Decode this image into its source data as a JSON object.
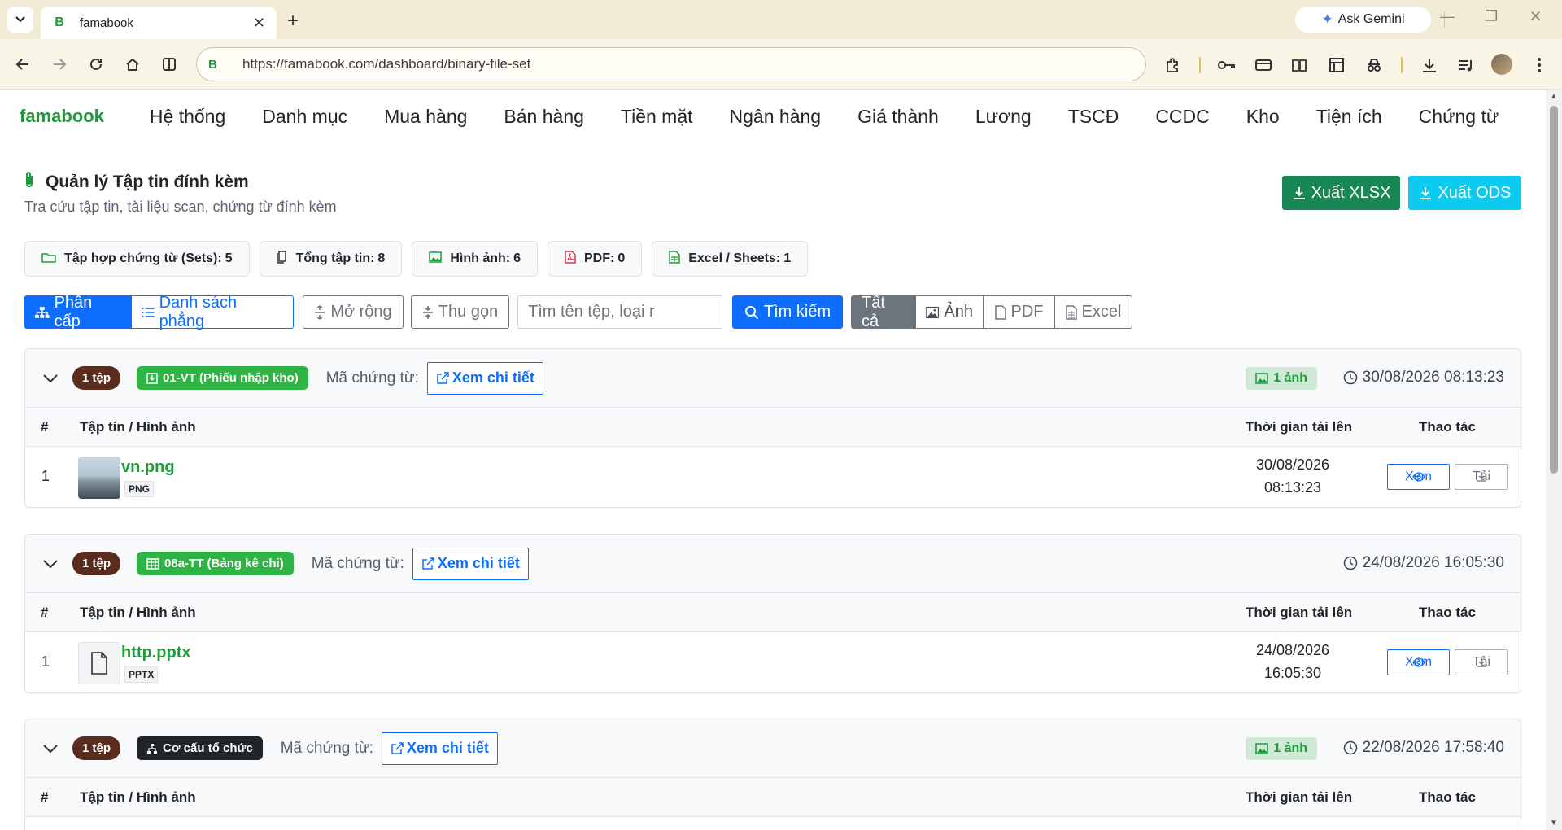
{
  "browser": {
    "tab_title": "famabook",
    "url": "https://famabook.com/dashboard/binary-file-set",
    "gemini_label": "Ask Gemini"
  },
  "nav": {
    "brand": "famabook",
    "items": [
      "Hệ thống",
      "Danh mục",
      "Mua hàng",
      "Bán hàng",
      "Tiền mặt",
      "Ngân hàng",
      "Giá thành",
      "Lương",
      "TSCĐ",
      "CCDC",
      "Kho",
      "Tiện ích",
      "Chứng từ"
    ]
  },
  "header": {
    "title": "Quản lý Tập tin đính kèm",
    "subtitle": "Tra cứu tập tin, tài liệu scan, chứng từ đính kèm",
    "export_xlsx": "Xuất XLSX",
    "export_ods": "Xuất ODS"
  },
  "stats": {
    "sets_label": "Tập hợp chứng từ (Sets):",
    "sets_value": "5",
    "files_label": "Tổng tập tin:",
    "files_value": "8",
    "images_label": "Hình ảnh:",
    "images_value": "6",
    "pdf_label": "PDF:",
    "pdf_value": "0",
    "excel_label": "Excel / Sheets:",
    "excel_value": "1"
  },
  "controls": {
    "hierarchy": "Phân cấp",
    "flat_list": "Danh sách phẳng",
    "expand": "Mở rộng",
    "collapse": "Thu gọn",
    "search_placeholder": "Tìm tên tệp, loại r",
    "search_button": "Tìm kiếm",
    "filter_all": "Tất cả",
    "filter_image": "Ảnh",
    "filter_pdf": "PDF",
    "filter_excel": "Excel"
  },
  "table_headers": {
    "index": "#",
    "file": "Tập tin / Hình ảnh",
    "uploaded": "Thời gian tải lên",
    "actions": "Thao tác"
  },
  "common": {
    "code_label": "Mã chứng từ:",
    "detail": "Xem chi tiết",
    "view": "Xem",
    "download": "Tải"
  },
  "sets": [
    {
      "count": "1 tệp",
      "type": "01-VT (Phiếu nhập kho)",
      "image_count": "1 ảnh",
      "time": "30/08/2026 08:13:23",
      "file": {
        "index": "1",
        "name": "vn.png",
        "ext": "PNG",
        "date": "30/08/2026",
        "time": "08:13:23"
      }
    },
    {
      "count": "1 tệp",
      "type": "08a-TT (Bảng kê chi)",
      "time": "24/08/2026 16:05:30",
      "file": {
        "index": "1",
        "name": "http.pptx",
        "ext": "PPTX",
        "date": "24/08/2026",
        "time": "16:05:30"
      }
    },
    {
      "count": "1 tệp",
      "type": "Cơ cấu tổ chức",
      "image_count": "1 ảnh",
      "time": "22/08/2026 17:58:40"
    }
  ],
  "colors": {
    "brand": "#1e9b3a",
    "primary": "#0d6efd",
    "success": "#198754",
    "info": "#0dcaf0"
  }
}
